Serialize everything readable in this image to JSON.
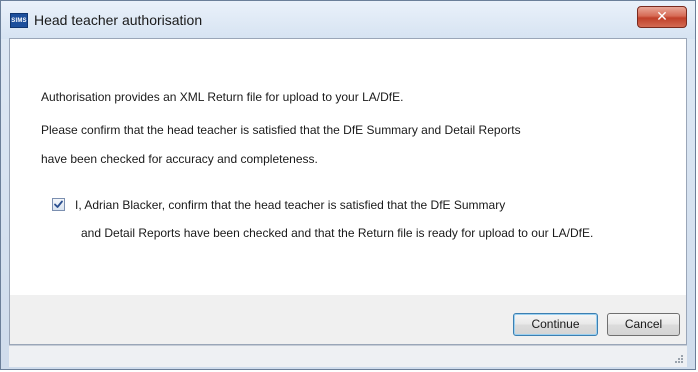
{
  "window": {
    "title": "Head teacher authorisation",
    "app_logo_text": "SIMS",
    "close_glyph": "✕"
  },
  "body": {
    "line1": "Authorisation provides an XML Return file for upload to your LA/DfE.",
    "line2": "Please confirm that the head teacher is satisfied that the DfE Summary and Detail Reports",
    "line3": "have been checked for accuracy and completeness."
  },
  "confirmation": {
    "checked": true,
    "label_line1": "I, Adrian Blacker, confirm that the head teacher is satisfied that the DfE Summary",
    "label_line2": "and Detail Reports have been checked and that the Return file is ready for upload to our LA/DfE."
  },
  "buttons": {
    "continue_label": "Continue",
    "cancel_label": "Cancel"
  },
  "icons": {
    "close": "close-icon",
    "checkmark": "checkmark-icon",
    "grip": "resize-grip-icon"
  },
  "colors": {
    "close_button": "#c0402a",
    "checkmark": "#2b4f8f",
    "title_bar": "#d6e3f2"
  }
}
